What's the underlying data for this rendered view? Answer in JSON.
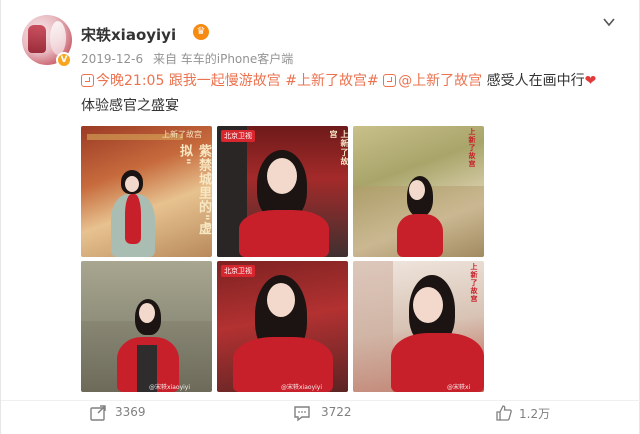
{
  "post": {
    "username": "宋轶xiaoyiyi",
    "date": "2019-12-6",
    "source": "来自 车车的iPhone客户端",
    "text_prefix": "今晚21:05",
    "topic1": "跟我一起慢游故宫",
    "topic2": "#上新了故宫#",
    "mention": "@上新了故宫",
    "text_body": "感受人在画中行",
    "heart": "❤",
    "text_suffix": " 体验感官之盛宴",
    "photos": [
      {
        "title_text": "紫禁城里的\"虚拟\"",
        "badge": "上新了故宫"
      },
      {
        "badge": "北京卫视",
        "corner": "上新了故宫"
      },
      {
        "badge": "上新了故宫"
      },
      {
        "watermark": "@宋轶xiaoyiyi"
      },
      {
        "badge": "北京卫视",
        "watermark": "@宋轶xiaoyiyi"
      },
      {
        "badge": "上新了故宫",
        "watermark": "@宋轶xi"
      }
    ]
  },
  "actions": {
    "repost_count": "3369",
    "comment_count": "3722",
    "like_count": "1.2万"
  },
  "colors": {
    "link": "#eb7350",
    "text": "#333333",
    "meta": "#939393"
  }
}
